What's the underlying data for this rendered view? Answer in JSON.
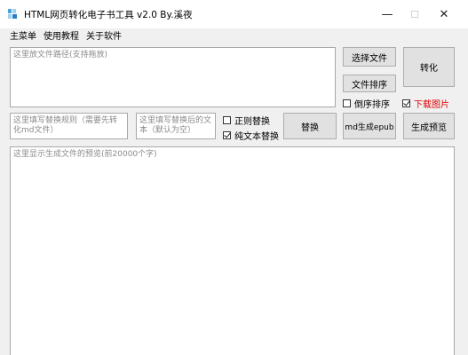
{
  "window": {
    "title": "HTML网页转化电子书工具 v2.0 By.溪夜",
    "minimize_symbol": "—",
    "maximize_symbol": "☐",
    "close_symbol": "✕"
  },
  "menu": {
    "items": [
      {
        "label": "主菜单"
      },
      {
        "label": "使用教程"
      },
      {
        "label": "关于软件"
      }
    ]
  },
  "file_path_input": {
    "placeholder": "这里放文件路径(支持拖放)"
  },
  "buttons": {
    "select_file": "选择文件",
    "sort_files": "文件排序",
    "convert": "转化",
    "replace": "替换",
    "md_to_epub": "md生成epub",
    "generate_preview": "生成预览"
  },
  "options": {
    "reverse_sort": {
      "label": "倒序排序",
      "checked": false
    },
    "download_images": {
      "label": "下载图片",
      "checked": true,
      "color": "#e00000"
    },
    "regex_replace": {
      "label": "正则替换",
      "checked": false
    },
    "plain_text_replace": {
      "label": "纯文本替换",
      "checked": true
    }
  },
  "replace_rule_input": {
    "placeholder": "这里填写替换规则（需要先转化md文件）"
  },
  "replace_with_input": {
    "placeholder": "这里填写替换后的文本（默认为空）"
  },
  "preview_area": {
    "placeholder": "这里显示生成文件的预览(前20000个字)"
  },
  "icons": {
    "app_icon": "document-icon"
  }
}
